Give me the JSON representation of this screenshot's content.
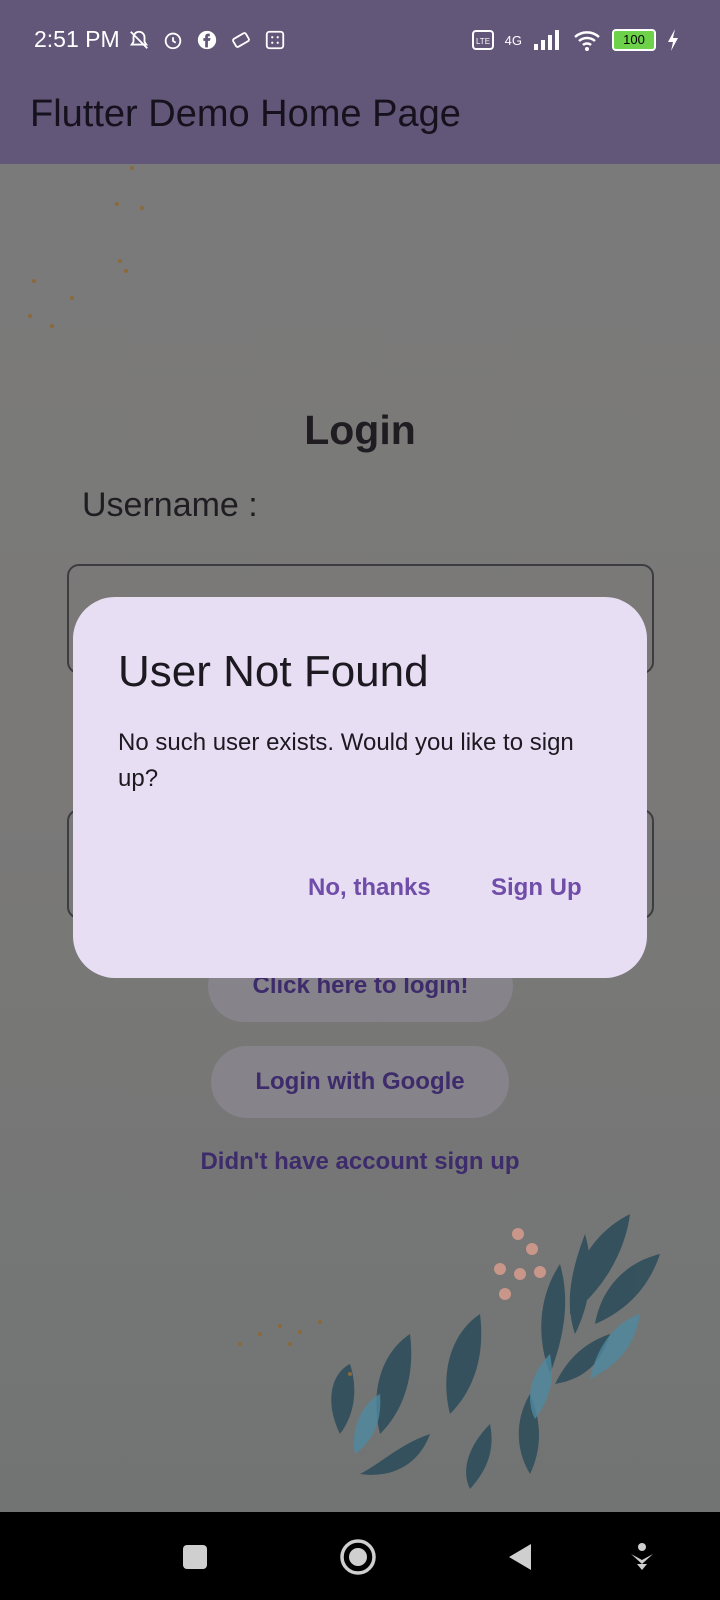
{
  "status_bar": {
    "time": "2:51 PM",
    "network": "4G",
    "battery": "100",
    "icons_left": [
      "mute-icon",
      "alarm-icon",
      "facebook-icon",
      "ticket-icon",
      "grid-icon"
    ],
    "icons_right": [
      "volte-icon",
      "signal-icon",
      "wifi-icon",
      "battery-icon",
      "charging-icon"
    ]
  },
  "app_bar": {
    "title": "Flutter Demo Home Page"
  },
  "login": {
    "title": "Login",
    "username_label": "Username :",
    "login_button": "Click here to login!",
    "google_button": "Login with Google",
    "signup_link": "Didn't have account sign up"
  },
  "dialog": {
    "title": "User Not Found",
    "message": "No such user exists. Would you like to sign up?",
    "actions": {
      "no": "No, thanks",
      "yes": "Sign Up"
    }
  },
  "nav_bar": {
    "icons": [
      "recents-icon",
      "home-icon",
      "back-icon",
      "accessibility-icon"
    ]
  },
  "colors": {
    "app_bar": "#625679",
    "dialog_bg": "#e8def4",
    "dialog_action": "#6f4da8",
    "button_text": "#3d2b6b"
  }
}
